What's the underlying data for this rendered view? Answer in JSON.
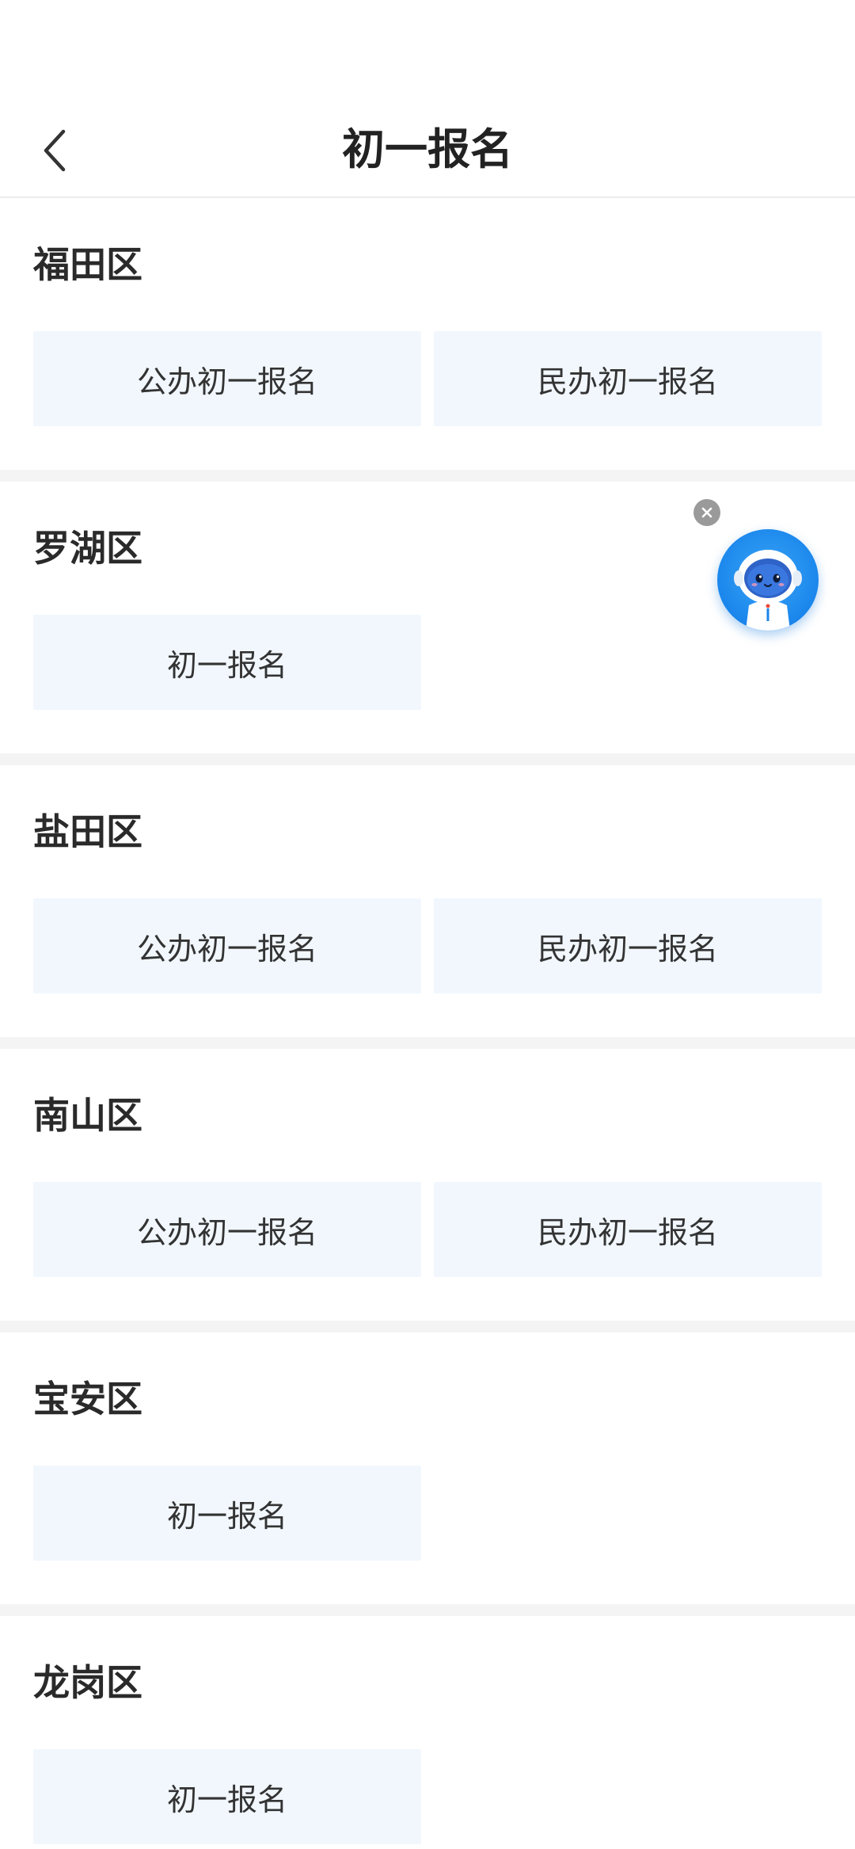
{
  "header": {
    "title": "初一报名"
  },
  "districts": [
    {
      "name": "福田区",
      "buttons": [
        "公办初一报名",
        "民办初一报名"
      ]
    },
    {
      "name": "罗湖区",
      "buttons": [
        "初一报名"
      ]
    },
    {
      "name": "盐田区",
      "buttons": [
        "公办初一报名",
        "民办初一报名"
      ]
    },
    {
      "name": "南山区",
      "buttons": [
        "公办初一报名",
        "民办初一报名"
      ]
    },
    {
      "name": "宝安区",
      "buttons": [
        "初一报名"
      ]
    },
    {
      "name": "龙岗区",
      "buttons": [
        "初一报名"
      ]
    }
  ],
  "icons": {
    "back": "chevron-left-icon",
    "assistant": "robot-assistant-icon",
    "close": "close-icon"
  },
  "colors": {
    "button_bg": "#f1f7fd",
    "divider": "#f4f4f4",
    "assistant": "#1a86ec"
  }
}
